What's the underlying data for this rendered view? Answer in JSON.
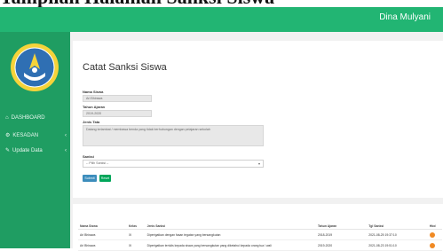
{
  "doc_heading": "Tampilan Halaman Sanksi Siswa",
  "header": {
    "user_name": "Dina Mulyani"
  },
  "sidebar": {
    "items": [
      {
        "label": "DASHBOARD",
        "icon": "home-icon",
        "has_children": false
      },
      {
        "label": "KESADAN",
        "icon": "settings-icon",
        "has_children": true
      },
      {
        "label": "Update Data",
        "icon": "pencil-icon",
        "has_children": true
      }
    ]
  },
  "form": {
    "title": "Catat Sanksi Siswa",
    "fields": {
      "nama_siswa": {
        "label": "Nama Siswa",
        "value": "Ari Bhirawa"
      },
      "tahun_ajaran": {
        "label": "Tahun Ajaran",
        "value": "2019-2020"
      },
      "jenis_tata": {
        "label": "Jenis Tata",
        "value": "Datang terlambat / membawa benda yang tidak berhubungan dengan pelajaran sekolah"
      },
      "sanksi": {
        "label": "Sanksi",
        "value": "-- Pilih Sanksi --"
      }
    },
    "buttons": {
      "submit": "Submit",
      "reset": "Reset"
    }
  },
  "history_table": {
    "columns": [
      "Nama Siswa",
      "Kelas",
      "Jenis Sanksi",
      "Tahun Ajaran",
      "Tgl Sanksi",
      "Hbd"
    ],
    "rows": [
      [
        "Ari Bhirawa",
        "XI",
        "Dipertgatkan dengan fasan tegatan yang bersangkutan",
        "2018-2019",
        "2021-08-25 19:37:10",
        ""
      ],
      [
        "Ari Bhirawa",
        "XI",
        "Dipertgatkan tertulis kepada siswa yang bersangkutan yang diketahui kepada orang tua / wali",
        "2019-2020",
        "2021-08-23 19:51:10",
        ""
      ]
    ]
  },
  "colors": {
    "topbar": "#22b573",
    "sidebar": "#1f9d62",
    "submit": "#3c8dbc",
    "reset": "#00a65a",
    "delete": "#f08a24"
  }
}
